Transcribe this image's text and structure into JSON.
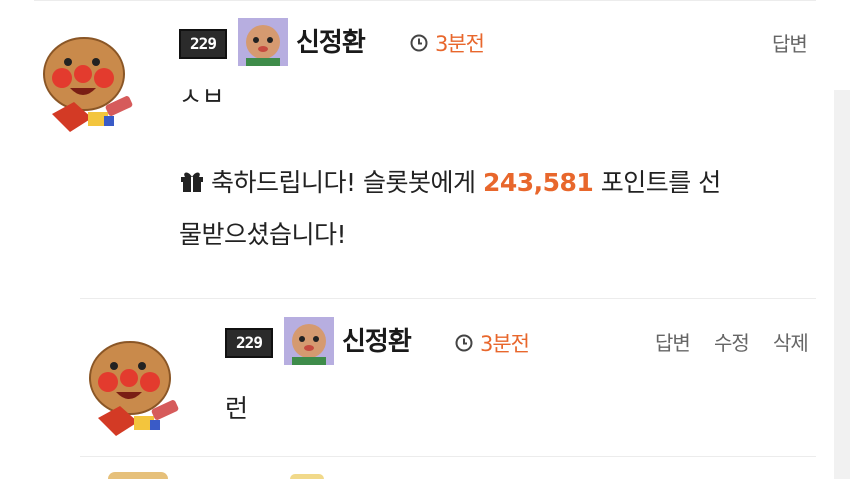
{
  "comment1": {
    "level": "229",
    "username": "신정환",
    "time": "3분전",
    "actions": [
      "답변"
    ],
    "partial_text": "ㅅㅂ",
    "gift_line_before": "축하드립니다! 슬롯봇에게",
    "gift_points": "243,581",
    "gift_line_after": "포인트를 선",
    "gift_line2": "물받으셨습니다!"
  },
  "comment2": {
    "level": "229",
    "username": "신정환",
    "time": "3분전",
    "actions": [
      "답변",
      "수정",
      "삭제"
    ],
    "text": "런"
  },
  "colors": {
    "accent": "#e8672c",
    "text": "#222222",
    "muted": "#666666",
    "divider": "#ececec"
  }
}
